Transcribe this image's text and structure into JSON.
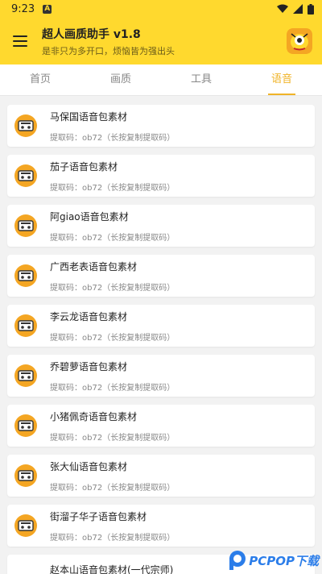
{
  "status": {
    "time": "9:23",
    "notification": "A"
  },
  "header": {
    "title": "超人画质助手 v1.8",
    "subtitle": "是非只为多开口，烦恼皆为强出头"
  },
  "tabs": [
    {
      "label": "首页"
    },
    {
      "label": "画质"
    },
    {
      "label": "工具"
    },
    {
      "label": "语音",
      "active": true
    }
  ],
  "items": [
    {
      "title": "马保国语音包素材",
      "code": "提取码：ob72（长按复制提取码）"
    },
    {
      "title": "茄子语音包素材",
      "code": "提取码：ob72（长按复制提取码）"
    },
    {
      "title": "阿giao语音包素材",
      "code": "提取码：ob72（长按复制提取码）"
    },
    {
      "title": "广西老表语音包素材",
      "code": "提取码：ob72（长按复制提取码）"
    },
    {
      "title": "李云龙语音包素材",
      "code": "提取码：ob72（长按复制提取码）"
    },
    {
      "title": "乔碧萝语音包素材",
      "code": "提取码：ob72（长按复制提取码）"
    },
    {
      "title": "小猪佩奇语音包素材",
      "code": "提取码：ob72（长按复制提取码）"
    },
    {
      "title": "张大仙语音包素材",
      "code": "提取码：ob72（长按复制提取码）"
    },
    {
      "title": "街溜子华子语音包素材",
      "code": "提取码：ob72（长按复制提取码）"
    },
    {
      "title": "赵本山语音包素材(一代宗师)",
      "code": ""
    }
  ],
  "watermark": {
    "text": "PCPOP下载"
  },
  "icons": {
    "menu": "hamburger-menu-icon",
    "avatar": "mascot-avatar-icon",
    "item": "cassette-tape-icon"
  },
  "colors": {
    "accent": "#ffd92e",
    "tab_active": "#f0b429",
    "icon_bg": "#f4a623"
  }
}
